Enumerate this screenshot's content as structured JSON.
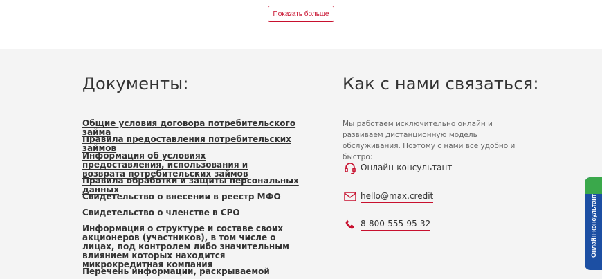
{
  "show_more": {
    "label": "Показать больше"
  },
  "documents": {
    "title": "Документы:",
    "links": [
      "Общие условия договора потребительского займа",
      "Правила предоставления потребительских займов",
      "Информация об условиях предоставления, использования и возврата потребительских займов",
      "Правила обработки и защиты персональных данных",
      "Свидетельство о внесении в реестр МФО",
      "Свидетельство о членстве в СРО",
      "Информация о структуре и составе своих акционеров (участников), в том числе о лицах, под контролем либо значительным влиянием которых находится микрокредитная компания",
      "Перечень информации, раскрываемой"
    ]
  },
  "contact": {
    "title": "Как с нами связаться:",
    "description": "Мы работаем исключительно онлайн и развиваем дистанционную модель обслуживания. Поэтому с нами все удобно и быстро:",
    "items": [
      {
        "icon": "headset-icon",
        "label": "Онлайн-консультант"
      },
      {
        "icon": "mail-icon",
        "label": "hello@max.credit"
      },
      {
        "icon": "phone-icon",
        "label": "8-800-555-95-32"
      }
    ]
  },
  "side_tab": {
    "label": "Онлайн-консультант"
  },
  "colors": {
    "accent": "#c8102e",
    "footer_bg": "#f4f4f4",
    "side_tab": "#1c4fa3",
    "side_tab_corner": "#3aa84b"
  }
}
